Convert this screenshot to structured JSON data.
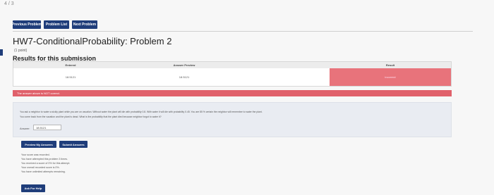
{
  "corner_text": "4 / 3",
  "nav": {
    "previous": "Previous Problem",
    "list": "Problem List",
    "next": "Next Problem"
  },
  "page_title": "HW7-ConditionalProbability: Problem 2",
  "points": "(1 point)",
  "results_heading": "Results for this submission",
  "results_table": {
    "headers": {
      "entered": "Entered",
      "answer_preview": "Answer Preview",
      "result": "Result"
    },
    "row": {
      "entered": "18.5121",
      "answer_preview": "18.5121",
      "result": "incorrect"
    }
  },
  "wrong_message": "The answer above is NOT correct.",
  "question": {
    "line1": "You ask a neighbor to water a sickly plant while you are on vacation. Without water the plant will die with probability 0.8. With water it will die with probability 0.45. You are 85 % certain the neighbor will remember to water the plant.",
    "line2": "You come back from the vacation and the plant is dead. What is the probability that the plant died because neighbor forgot to water it?",
    "answer_label": "Answer:",
    "answer_value": "18.5121"
  },
  "buttons": {
    "preview": "Preview My Answers",
    "submit": "Submit Answers"
  },
  "status_lines": [
    "Your score was recorded.",
    "You have attempted this problem 3 times.",
    "You received a score of 0% for this attempt.",
    "Your overall recorded score is 0%.",
    "You have unlimited attempts remaining."
  ],
  "help_button": "Ask For Help",
  "colors": {
    "nav": "#1f3d7a",
    "incorrect": "#e0616b"
  }
}
